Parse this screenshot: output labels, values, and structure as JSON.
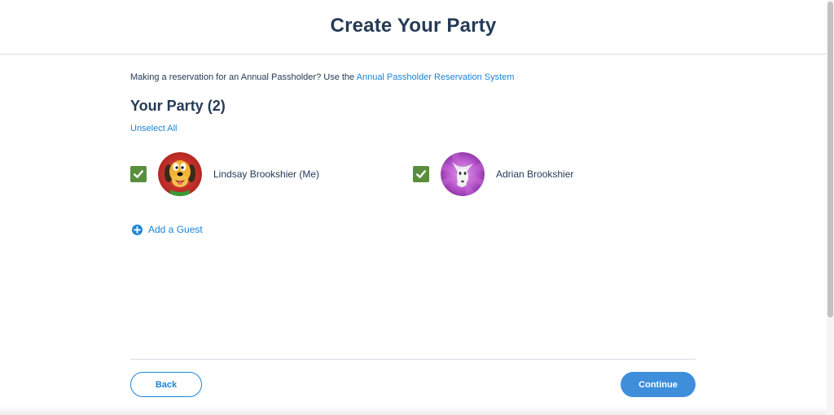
{
  "header": {
    "title": "Create Your Party"
  },
  "notice": {
    "text": "Making a reservation for an Annual Passholder? Use the ",
    "link_label": "Annual Passholder Reservation System"
  },
  "party": {
    "heading": "Your Party (2)",
    "unselect_all_label": "Unselect All",
    "guests": [
      {
        "name": "Lindsay Brookshier (Me)",
        "checked": true,
        "avatar_icon": "pluto-avatar"
      },
      {
        "name": "Adrian Brookshier",
        "checked": true,
        "avatar_icon": "zero-ghost-dog-avatar"
      }
    ],
    "add_guest_label": "Add a Guest"
  },
  "footer": {
    "back_label": "Back",
    "continue_label": "Continue"
  },
  "colors": {
    "title": "#253b56",
    "link": "#1a85d6",
    "checkbox": "#5b8e3c",
    "continue_bg": "#3e8edb",
    "divider": "#d9dde3"
  }
}
